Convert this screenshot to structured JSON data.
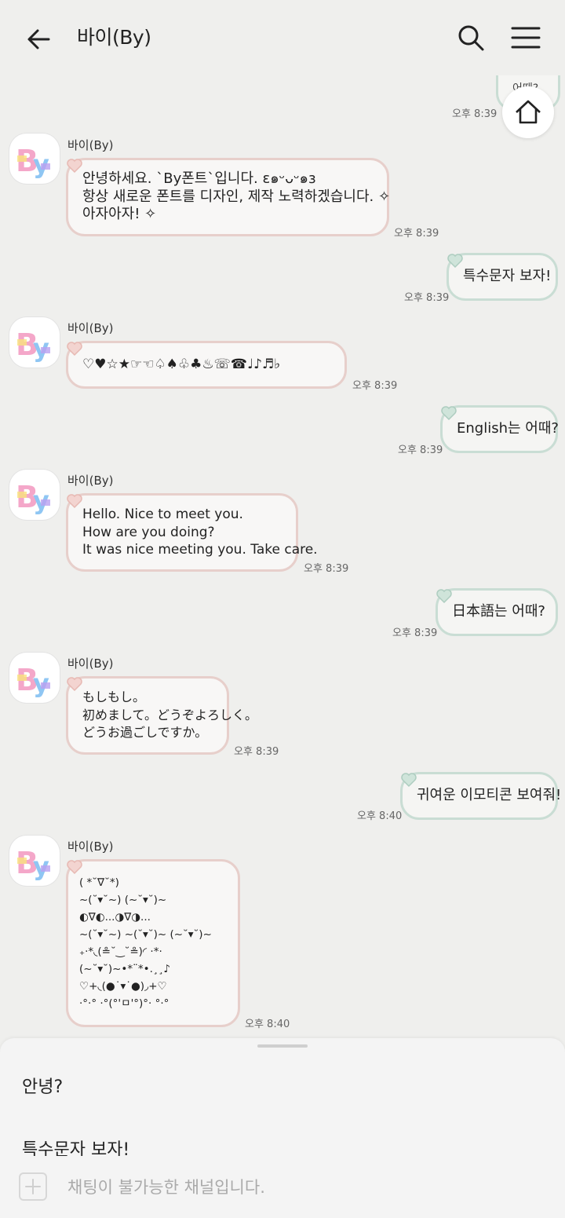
{
  "header": {
    "title": "바이(By)"
  },
  "partial_bubble": {
    "text": "어때?"
  },
  "partial_time": "오후 8:39",
  "messages": [
    {
      "side": "left",
      "sender": "바이(By)",
      "text": "안녕하세요. `By폰트`입니다. ε๑ᵕᴗᵕ๑ɜ\n항상 새로운 폰트를 디자인, 제작 노력하겠습니다. ✧\n아자아자! ✧",
      "time": "오후 8:39"
    },
    {
      "side": "right",
      "text": "특수문자 보자!",
      "time": "오후 8:39"
    },
    {
      "side": "left",
      "sender": "바이(By)",
      "text": "♡♥☆★☞☜♤♠♧♣♨☏☎♩♪♬♭",
      "time": "오후 8:39"
    },
    {
      "side": "right",
      "text": "English는 어때?",
      "time": "오후 8:39"
    },
    {
      "side": "left",
      "sender": "바이(By)",
      "text": "Hello. Nice to meet you.\nHow are you doing?\nIt was nice meeting you. Take care.",
      "time": "오후 8:39"
    },
    {
      "side": "right",
      "text": "日本語는 어때?",
      "time": "오후 8:39"
    },
    {
      "side": "left",
      "sender": "바이(By)",
      "text": "もしもし。\n初めまして。どうぞよろしく。\nどうお過ごしですか。",
      "time": "오후 8:39"
    },
    {
      "side": "right",
      "text": "귀여운 이모티콘 보여줘!",
      "time": "오후 8:40"
    },
    {
      "side": "left",
      "sender": "바이(By)",
      "text": "( *˘∇˘*)\n~(˘▾˘~) (~˘▾˘)~\n◐∇◐...◑∇◑...\n~(˘▾˘~) ~(˘▾˘)~ (~˘▾˘)~\n₊·*◟(≗˘‿˘≗)◜ ·*·\n(~˘▾˘)~•*¨*•.¸¸♪\n♡+◟(●˙▾˙●)◞+♡\n·°·° ·°(°'ㅁ'°)°· °·°",
      "time": "오후 8:40"
    }
  ],
  "sheet": {
    "suggestions": [
      "안녕?",
      "특수문자 보자!"
    ],
    "input_placeholder": "채팅이 불가능한 채널입니다."
  },
  "colors": {
    "left_border": "#e7cfcb",
    "right_border": "#c9ddd4",
    "background": "#efefed"
  }
}
